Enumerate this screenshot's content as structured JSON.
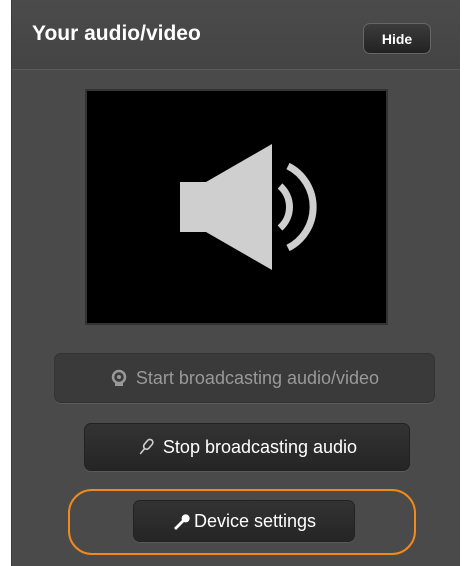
{
  "panel": {
    "title": "Your audio/video",
    "hide_label": "Hide"
  },
  "preview": {
    "icon": "speaker-icon"
  },
  "buttons": {
    "start_label": "Start broadcasting audio/video",
    "start_icon": "webcam-icon",
    "start_enabled": false,
    "stop_label": "Stop broadcasting audio",
    "stop_icon": "microphone-icon",
    "settings_label": "Device settings",
    "settings_icon": "wrench-icon"
  },
  "colors": {
    "panel_bg": "#4a4a4a",
    "highlight": "#f08a1c",
    "icon_gray": "#cfcfcf"
  }
}
